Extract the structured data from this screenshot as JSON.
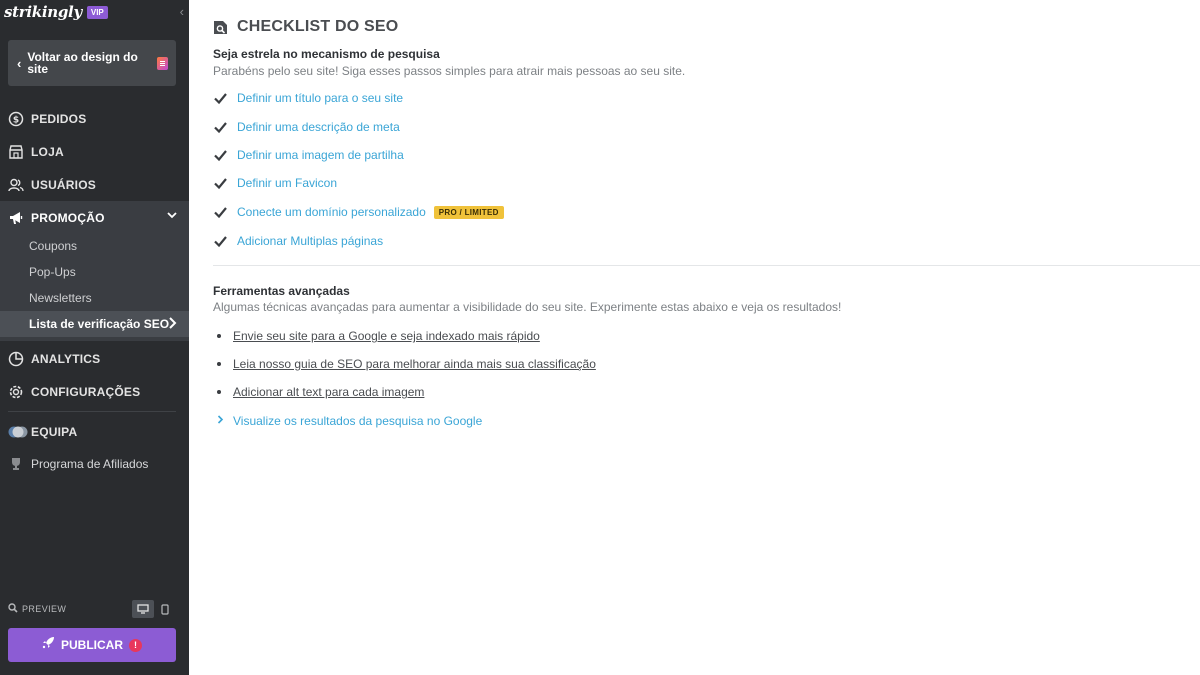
{
  "brand": {
    "logo": "strikingly",
    "badge": "VIP"
  },
  "sidebar": {
    "back_label": "Voltar ao design do site",
    "nav": [
      {
        "id": "pedidos",
        "label": "PEDIDOS",
        "icon": "dollar-circle-icon"
      },
      {
        "id": "loja",
        "label": "LOJA",
        "icon": "store-icon"
      },
      {
        "id": "usuarios",
        "label": "USUÁRIOS",
        "icon": "users-icon"
      },
      {
        "id": "promocao",
        "label": "PROMOÇÃO",
        "icon": "megaphone-icon"
      },
      {
        "id": "analytics",
        "label": "ANALYTICS",
        "icon": "pie-chart-icon"
      },
      {
        "id": "configuracoes",
        "label": "CONFIGURAÇÕES",
        "icon": "gear-icon"
      },
      {
        "id": "equipa",
        "label": "EQUIPA",
        "icon": "team-icon"
      }
    ],
    "promo_sub": [
      {
        "label": "Coupons"
      },
      {
        "label": "Pop-Ups"
      },
      {
        "label": "Newsletters"
      },
      {
        "label": "Lista de verificação SEO"
      }
    ],
    "affiliate_label": "Programa de Afiliados",
    "preview_label": "PREVIEW",
    "publish_label": "PUBLICAR",
    "publish_alert": "!"
  },
  "main": {
    "title": "CHECKLIST DO SEO",
    "section1": {
      "heading": "Seja estrela no mecanismo de pesquisa",
      "description": "Parabéns pelo seu site! Siga esses passos simples para atrair mais pessoas ao seu site.",
      "items": [
        {
          "label": "Definir um título para o seu site",
          "checked": true
        },
        {
          "label": "Definir uma descrição de meta",
          "checked": true
        },
        {
          "label": "Definir uma imagem de partilha",
          "checked": true
        },
        {
          "label": "Definir um Favicon",
          "checked": true
        },
        {
          "label": "Conecte um domínio personalizado",
          "checked": true,
          "badge": "PRO / LIMITED"
        },
        {
          "label": "Adicionar Multiplas páginas",
          "checked": true
        }
      ]
    },
    "section2": {
      "heading": "Ferramentas avançadas",
      "description": "Algumas técnicas avançadas para aumentar a visibilidade do seu site. Experimente estas abaixo e veja os resultados!",
      "links": [
        "Envie seu site para a Google e seja indexado mais rápido",
        "Leia nosso guia de SEO para melhorar ainda mais sua classificação",
        "Adicionar alt text para cada imagem"
      ],
      "expand_link": "Visualize os resultados da pesquisa no Google"
    }
  },
  "colors": {
    "sidebar_bg": "#2a2c2f",
    "accent_purple": "#8c5cd4",
    "link_blue": "#3aa5d6",
    "badge_yellow": "#f0c23a"
  }
}
